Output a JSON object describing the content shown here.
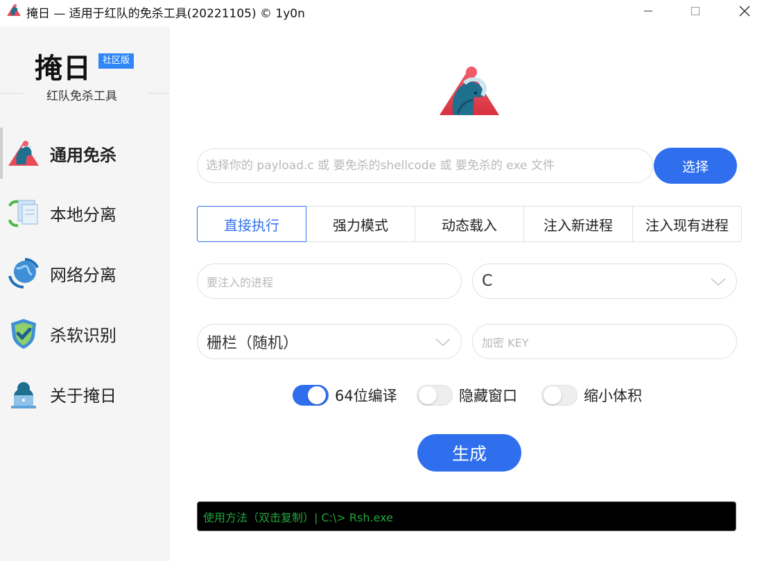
{
  "window": {
    "title": "掩日 — 适用于红队的免杀工具(20221105) © 1y0n",
    "app_icon": "horse-logo-icon",
    "controls": [
      "minimize-icon",
      "maximize-icon",
      "close-icon"
    ]
  },
  "sidebar": {
    "brand": "掩日",
    "edition_badge": "社区版",
    "subtitle": "红队免杀工具",
    "items": [
      {
        "label": "通用免杀",
        "icon": "horse-logo-icon",
        "active": true
      },
      {
        "label": "本地分离",
        "icon": "documents-sync-icon",
        "active": false
      },
      {
        "label": "网络分离",
        "icon": "globe-sync-icon",
        "active": false
      },
      {
        "label": "杀软识别",
        "icon": "shield-check-icon",
        "active": false
      },
      {
        "label": "关于掩日",
        "icon": "user-laptop-icon",
        "active": false
      }
    ]
  },
  "main": {
    "logo_icon": "horse-logo-icon",
    "file_input": {
      "placeholder": "选择你的 payload.c 或 要免杀的shellcode 或 要免杀的 exe 文件",
      "value": ""
    },
    "select_button": "选择",
    "tabs": [
      {
        "label": "直接执行",
        "active": true
      },
      {
        "label": "强力模式",
        "active": false
      },
      {
        "label": "动态载入",
        "active": false
      },
      {
        "label": "注入新进程",
        "active": false
      },
      {
        "label": "注入现有进程",
        "active": false
      }
    ],
    "process_input": {
      "placeholder": "要注入的进程"
    },
    "language_select": {
      "value": "C"
    },
    "encrypt_select": {
      "value": "栅栏（随机）"
    },
    "key_input": {
      "placeholder": "加密 KEY"
    },
    "toggles": [
      {
        "label": "64位编译",
        "on": true
      },
      {
        "label": "隐藏窗口",
        "on": false
      },
      {
        "label": "缩小体积",
        "on": false
      }
    ],
    "generate_button": "生成",
    "console_text": "使用方法（双击复制）|  C:\\> Rsh.exe"
  },
  "colors": {
    "accent": "#2f6fed",
    "badge": "#2f86f6",
    "sidebar_bg": "#f5f5f5",
    "console_bg": "#000000",
    "console_text": "#1fa73a"
  }
}
